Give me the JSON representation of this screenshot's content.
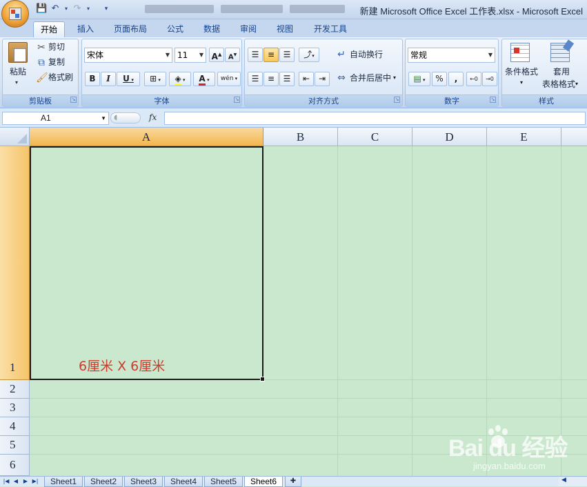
{
  "window": {
    "title": "新建 Microsoft Office Excel 工作表.xlsx - Microsoft Excel"
  },
  "ribbon": {
    "tabs": [
      "开始",
      "插入",
      "页面布局",
      "公式",
      "数据",
      "审阅",
      "视图",
      "开发工具"
    ],
    "clipboard": {
      "paste": "粘贴",
      "cut": "剪切",
      "copy": "复制",
      "format_painter": "格式刷",
      "label": "剪贴板"
    },
    "font": {
      "name": "宋体",
      "size": "11",
      "grow": "A",
      "shrink": "A",
      "bold": "B",
      "italic": "I",
      "underline": "U",
      "font_color": "A",
      "phonetic": "wén",
      "label": "字体"
    },
    "alignment": {
      "wrap_text": "自动换行",
      "merge_center": "合并后居中",
      "label": "对齐方式"
    },
    "number": {
      "format": "常规",
      "percent": "%",
      "comma": ",",
      "label": "数字"
    },
    "styles": {
      "conditional": "条件格式",
      "table_format_line1": "套用",
      "table_format_line2": "表格格式",
      "label": "样式"
    }
  },
  "formula_bar": {
    "name_box": "A1",
    "fx": "fx",
    "value": ""
  },
  "grid": {
    "columns": [
      "A",
      "B",
      "C",
      "D",
      "E"
    ],
    "rows": [
      "1",
      "2",
      "3",
      "4",
      "5",
      "6"
    ],
    "selected_cell": "A1",
    "a1_text": "6厘米 X 6厘米",
    "background_color": "#c9e8cd",
    "text_color": "#d0392b"
  },
  "sheets": {
    "tabs": [
      "Sheet1",
      "Sheet2",
      "Sheet3",
      "Sheet4",
      "Sheet5",
      "Sheet6"
    ],
    "active": "Sheet6"
  },
  "watermark": {
    "logo": "Bai du 经验",
    "url": "jingyan.baidu.com"
  }
}
